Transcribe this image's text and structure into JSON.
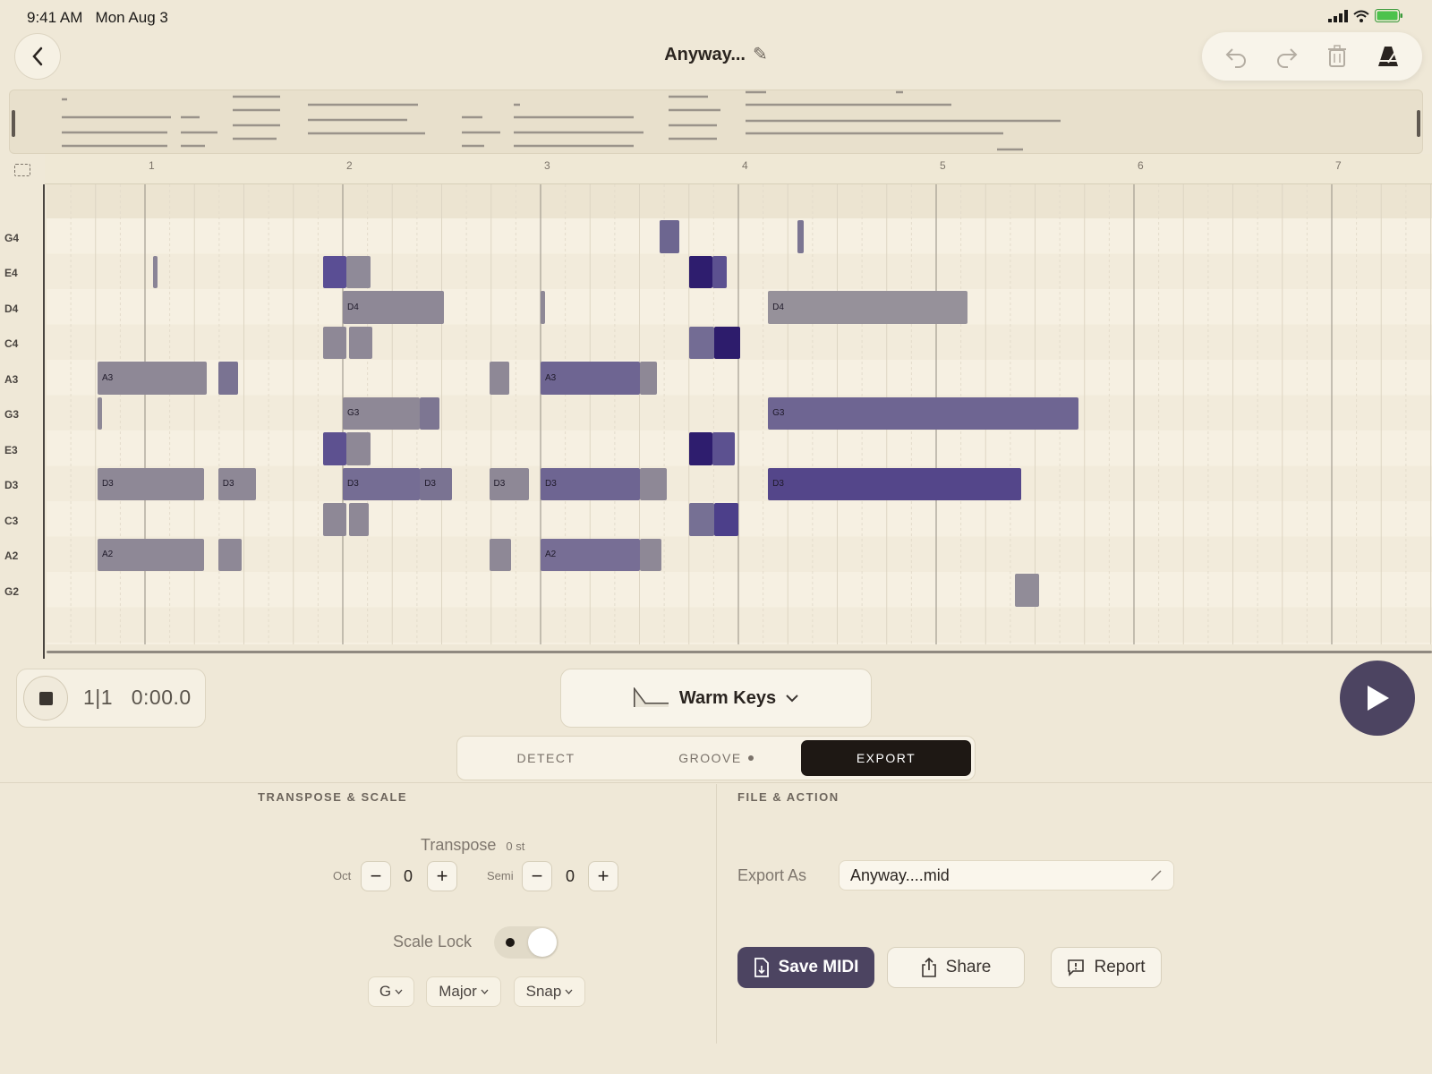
{
  "status": {
    "time": "9:41 AM",
    "date": "Mon Aug 3"
  },
  "header": {
    "title": "Anyway...",
    "pencil": "✎"
  },
  "toolbar": {
    "icons": [
      "undo-icon",
      "redo-icon",
      "trash-icon",
      "metronome-icon"
    ]
  },
  "ruler": {
    "bars": [
      "1",
      "2",
      "3",
      "4",
      "5",
      "6",
      "7"
    ]
  },
  "keys": [
    "G4",
    "E4",
    "D4",
    "C4",
    "A3",
    "G3",
    "E3",
    "D3",
    "C3",
    "A2",
    "G2"
  ],
  "notes": [
    {
      "label": "",
      "row": 1,
      "start": 0.04,
      "len": 0.01,
      "color": "#8a8496"
    },
    {
      "label": "",
      "row": 0,
      "start": 2.6,
      "len": 0.1,
      "color": "#6d6690"
    },
    {
      "label": "",
      "row": 0,
      "start": 3.3,
      "len": 0.03,
      "color": "#7b7592"
    },
    {
      "label": "",
      "row": 1,
      "start": 0.9,
      "len": 0.12,
      "color": "#5a4e94"
    },
    {
      "label": "",
      "row": 1,
      "start": 1.02,
      "len": 0.12,
      "color": "#8f8a98"
    },
    {
      "label": "",
      "row": 1,
      "start": 2.75,
      "len": 0.12,
      "color": "#2e1d6e"
    },
    {
      "label": "",
      "row": 1,
      "start": 2.87,
      "len": 0.07,
      "color": "#5c5190"
    },
    {
      "label": "D4",
      "row": 2,
      "start": 1.0,
      "len": 0.51,
      "color": "#8e8896"
    },
    {
      "label": "",
      "row": 2,
      "start": 2.0,
      "len": 0.02,
      "color": "#8e8896"
    },
    {
      "label": "D4",
      "row": 2,
      "start": 3.15,
      "len": 1.01,
      "color": "#96919a"
    },
    {
      "label": "",
      "row": 3,
      "start": 0.9,
      "len": 0.12,
      "color": "#8e8896"
    },
    {
      "label": "",
      "row": 3,
      "start": 1.03,
      "len": 0.12,
      "color": "#8e8896"
    },
    {
      "label": "",
      "row": 3,
      "start": 2.75,
      "len": 0.13,
      "color": "#736c94"
    },
    {
      "label": "",
      "row": 3,
      "start": 2.88,
      "len": 0.13,
      "color": "#2d1c6c"
    },
    {
      "label": "A3",
      "row": 4,
      "start": -0.24,
      "len": 0.55,
      "color": "#8e8896"
    },
    {
      "label": "",
      "row": 4,
      "start": 0.37,
      "len": 0.1,
      "color": "#7a7392"
    },
    {
      "label": "",
      "row": 4,
      "start": 1.74,
      "len": 0.1,
      "color": "#8e8896"
    },
    {
      "label": "A3",
      "row": 4,
      "start": 2.0,
      "len": 0.5,
      "color": "#6e6592"
    },
    {
      "label": "",
      "row": 4,
      "start": 2.5,
      "len": 0.09,
      "color": "#8e8896"
    },
    {
      "label": "",
      "row": 5,
      "start": -0.24,
      "len": 0.02,
      "color": "#8e8896"
    },
    {
      "label": "G3",
      "row": 5,
      "start": 1.0,
      "len": 0.39,
      "color": "#8e8896"
    },
    {
      "label": "",
      "row": 5,
      "start": 1.39,
      "len": 0.1,
      "color": "#7d7692"
    },
    {
      "label": "G3",
      "row": 5,
      "start": 3.15,
      "len": 1.57,
      "color": "#6e6592"
    },
    {
      "label": "",
      "row": 6,
      "start": 0.9,
      "len": 0.12,
      "color": "#5d5190"
    },
    {
      "label": "",
      "row": 6,
      "start": 1.02,
      "len": 0.12,
      "color": "#8e8896"
    },
    {
      "label": "",
      "row": 6,
      "start": 2.75,
      "len": 0.12,
      "color": "#2e1d6e"
    },
    {
      "label": "",
      "row": 6,
      "start": 2.87,
      "len": 0.11,
      "color": "#5c5190"
    },
    {
      "label": "D3",
      "row": 7,
      "start": -0.24,
      "len": 0.54,
      "color": "#8e8896"
    },
    {
      "label": "D3",
      "row": 7,
      "start": 0.37,
      "len": 0.19,
      "color": "#8e8896"
    },
    {
      "label": "D3",
      "row": 7,
      "start": 1.0,
      "len": 0.39,
      "color": "#756d94"
    },
    {
      "label": "D3",
      "row": 7,
      "start": 1.39,
      "len": 0.16,
      "color": "#7a7392"
    },
    {
      "label": "D3",
      "row": 7,
      "start": 1.74,
      "len": 0.2,
      "color": "#8e8896"
    },
    {
      "label": "D3",
      "row": 7,
      "start": 2.0,
      "len": 0.5,
      "color": "#6e6592"
    },
    {
      "label": "",
      "row": 7,
      "start": 2.5,
      "len": 0.14,
      "color": "#8e8896"
    },
    {
      "label": "D3",
      "row": 7,
      "start": 3.15,
      "len": 1.28,
      "color": "#54468a"
    },
    {
      "label": "",
      "row": 8,
      "start": 0.9,
      "len": 0.12,
      "color": "#8e8896"
    },
    {
      "label": "",
      "row": 8,
      "start": 1.03,
      "len": 0.1,
      "color": "#8e8896"
    },
    {
      "label": "",
      "row": 8,
      "start": 2.75,
      "len": 0.13,
      "color": "#767094"
    },
    {
      "label": "",
      "row": 8,
      "start": 2.88,
      "len": 0.12,
      "color": "#4c3f8a"
    },
    {
      "label": "A2",
      "row": 9,
      "start": -0.24,
      "len": 0.54,
      "color": "#8e8896"
    },
    {
      "label": "",
      "row": 9,
      "start": 0.37,
      "len": 0.12,
      "color": "#8e8896"
    },
    {
      "label": "",
      "row": 9,
      "start": 1.74,
      "len": 0.11,
      "color": "#8e8896"
    },
    {
      "label": "A2",
      "row": 9,
      "start": 2.0,
      "len": 0.5,
      "color": "#776e95"
    },
    {
      "label": "",
      "row": 9,
      "start": 2.5,
      "len": 0.11,
      "color": "#8e8896"
    },
    {
      "label": "",
      "row": 10,
      "start": 4.4,
      "len": 0.12,
      "color": "#918c98"
    }
  ],
  "transport": {
    "position": "1|1",
    "time": "0:00.0"
  },
  "instrument": {
    "name": "Warm Keys"
  },
  "tabs": {
    "detect": "DETECT",
    "groove": "GROOVE",
    "export": "EXPORT"
  },
  "transpose": {
    "section_title": "TRANSPOSE & SCALE",
    "label": "Transpose",
    "value_label": "0 st",
    "oct_label": "Oct",
    "oct_value": "0",
    "semi_label": "Semi",
    "semi_value": "0",
    "minus": "−",
    "plus": "+"
  },
  "scale": {
    "label": "Scale Lock",
    "key": "G",
    "mode": "Major",
    "snap": "Snap"
  },
  "file": {
    "section_title": "FILE & ACTION",
    "export_as_label": "Export As",
    "filename": "Anyway....mid",
    "save_label": "Save MIDI",
    "share_label": "Share",
    "report_label": "Report"
  },
  "colors": {
    "accent": "#4c4461",
    "background": "#efe8d7",
    "note_gray": "#8e8896"
  }
}
